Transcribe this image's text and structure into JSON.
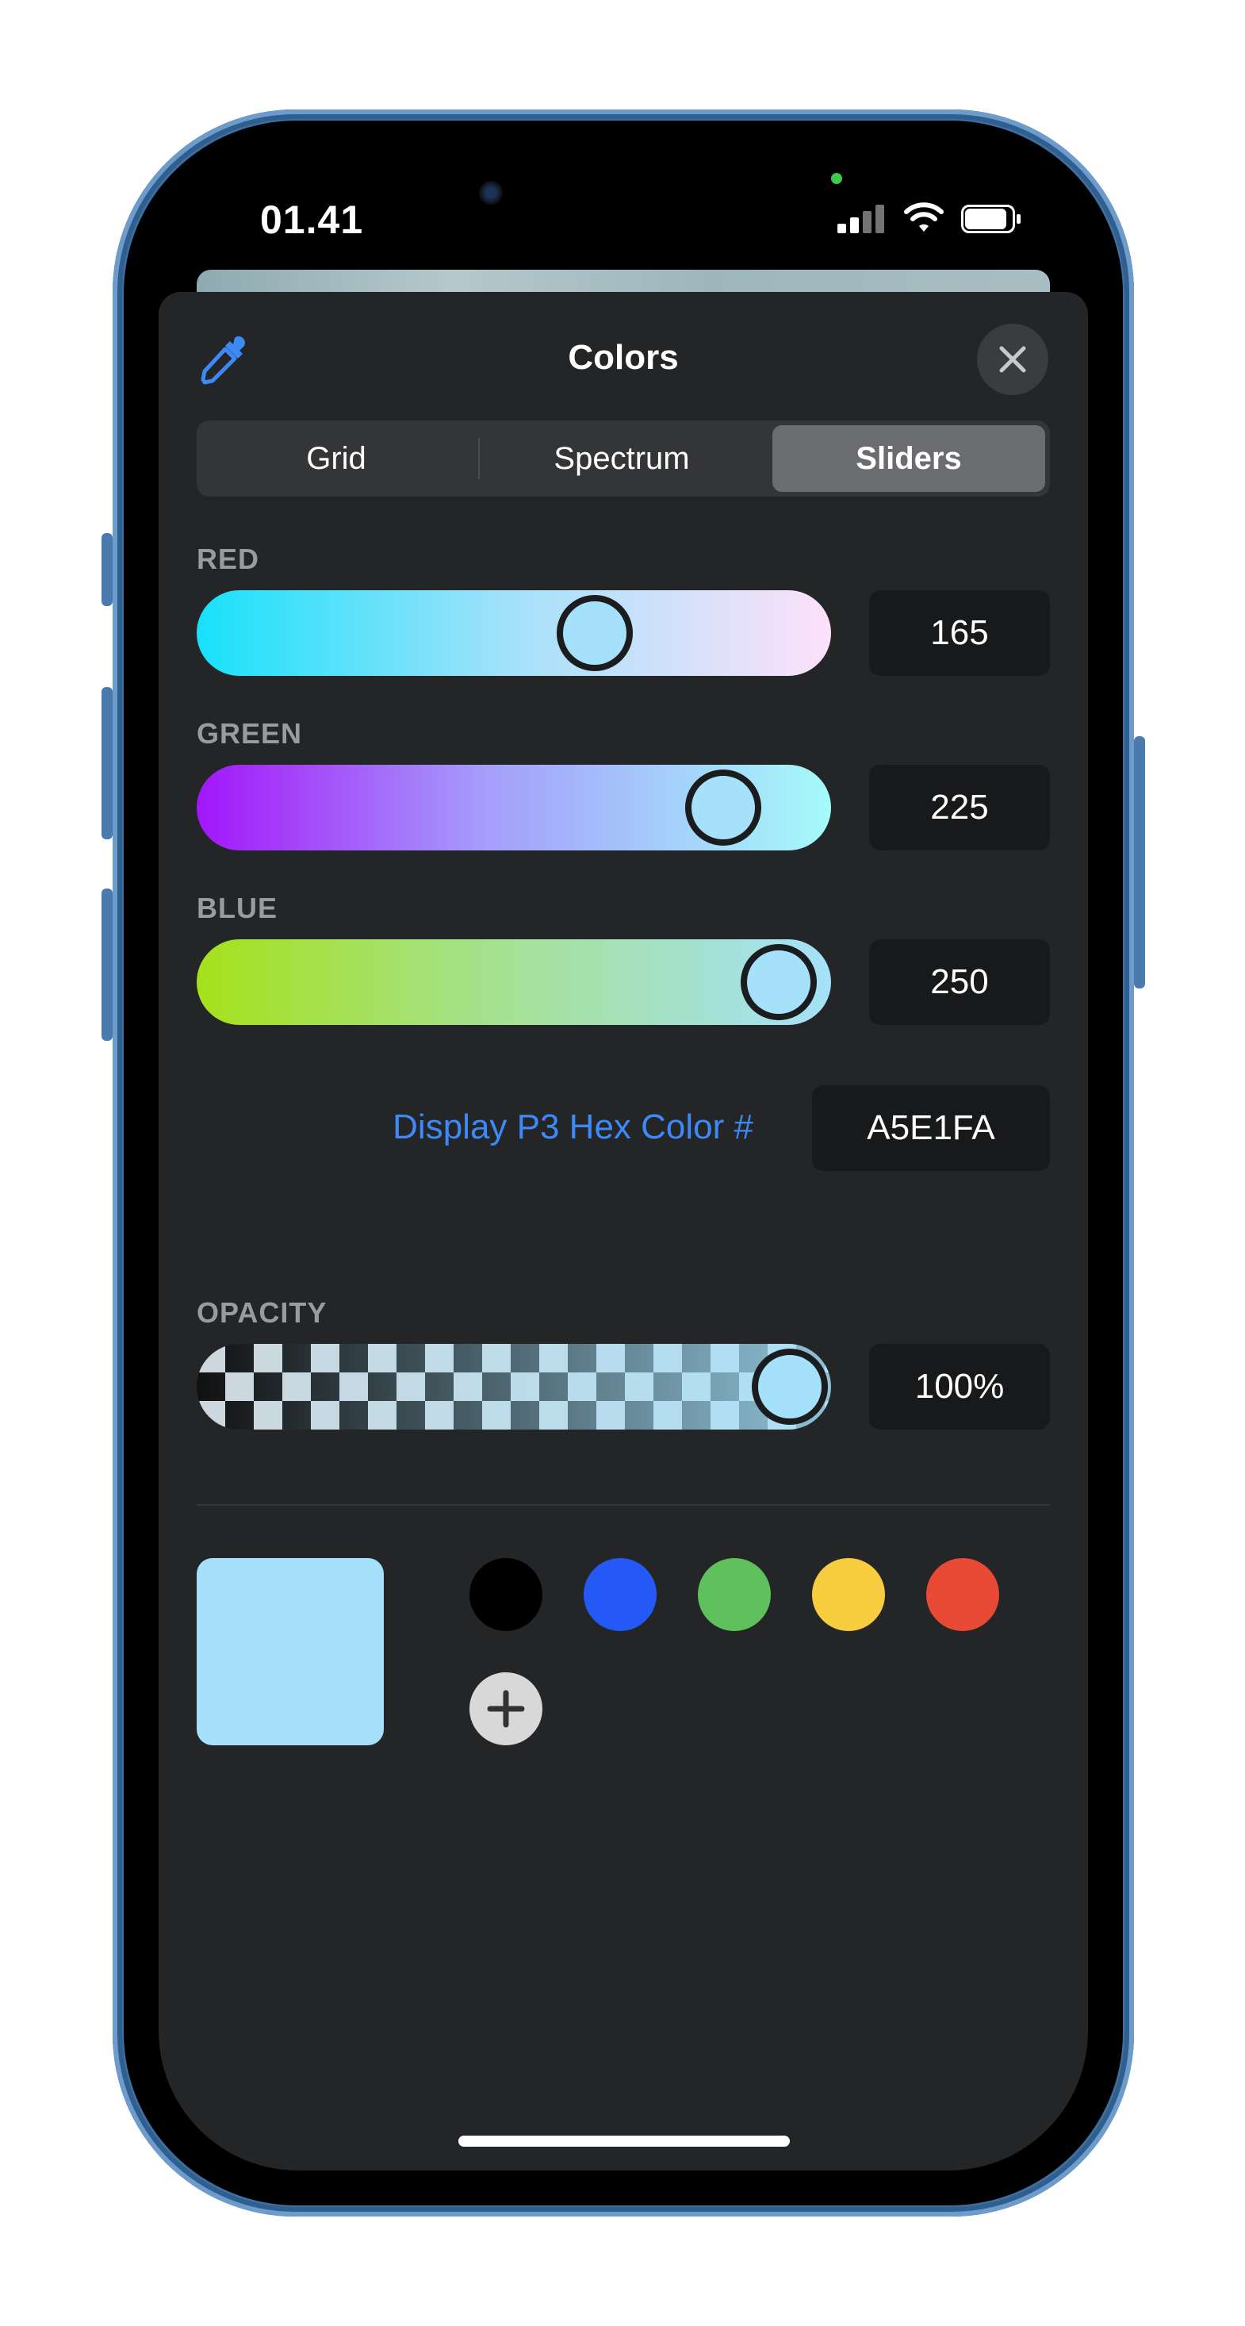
{
  "status_bar": {
    "time": "01.41"
  },
  "header": {
    "title": "Colors",
    "eyedropper_icon": "eyedropper-icon",
    "close_icon": "close-icon"
  },
  "tabs": [
    {
      "label": "Grid",
      "selected": false
    },
    {
      "label": "Spectrum",
      "selected": false
    },
    {
      "label": "Sliders",
      "selected": true
    }
  ],
  "sliders": {
    "red": {
      "label": "RED",
      "value": "165"
    },
    "green": {
      "label": "GREEN",
      "value": "225"
    },
    "blue": {
      "label": "BLUE",
      "value": "250"
    },
    "opacity": {
      "label": "OPACITY",
      "value": "100%"
    }
  },
  "hex": {
    "label": "Display P3 Hex Color #",
    "value": "A5E1FA"
  },
  "current_color": "#A5E1FA",
  "swatches": [
    "#000000",
    "#2459f5",
    "#5fc15c",
    "#f8cc3f",
    "#e84a36"
  ],
  "add_swatch_icon": "plus-icon"
}
